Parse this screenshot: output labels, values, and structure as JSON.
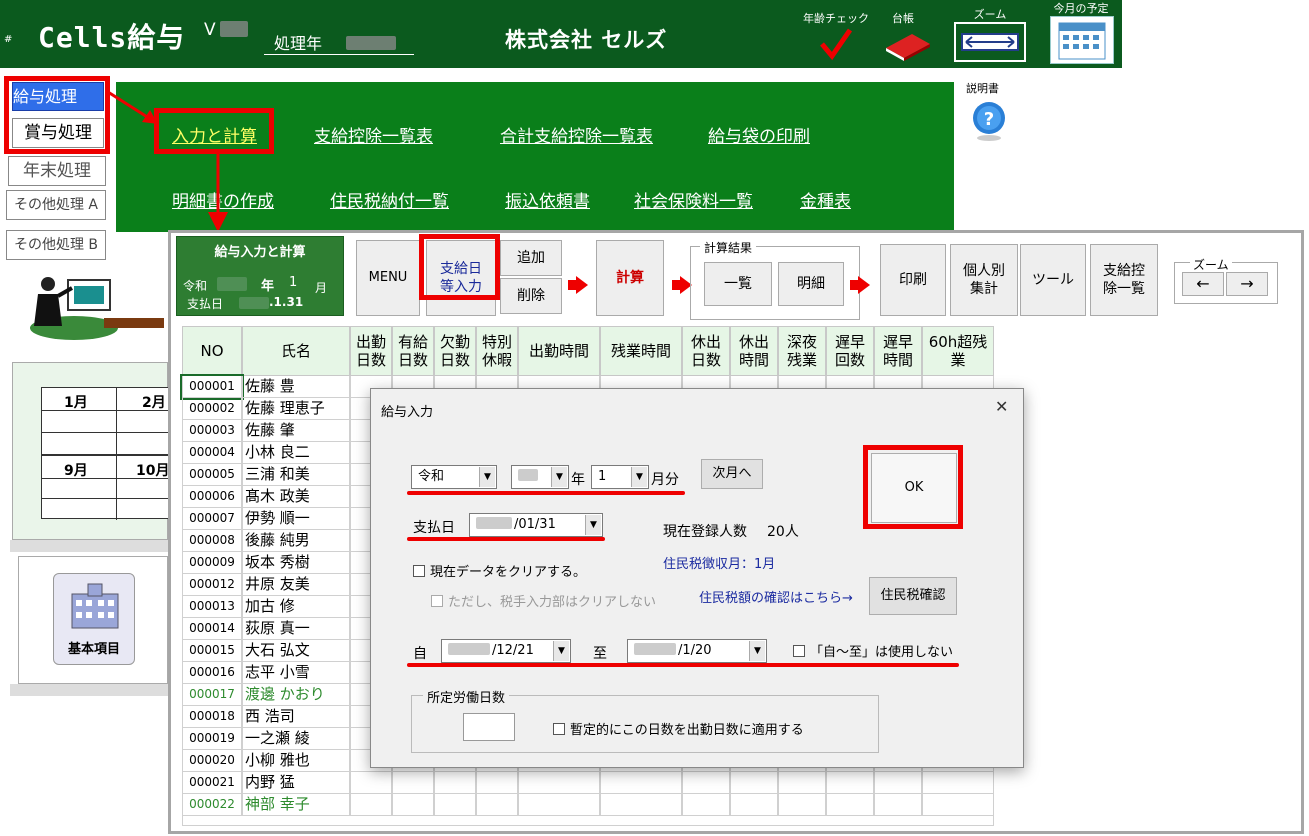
{
  "app": {
    "title": "Cells給与",
    "version_prefix": "V",
    "process_year_label": "処理年",
    "company": "株式会社 セルズ"
  },
  "top_icons": {
    "age_check": "年齢チェック",
    "ledger": "台帳",
    "zoom": "ズーム",
    "month_plan": "今月の予定",
    "manual": "説明書"
  },
  "left_nav": {
    "payroll": "給与処理",
    "bonus": "賞与処理",
    "year_end": "年末処理",
    "other_a": "その他処理 A",
    "other_b": "その他処理 B",
    "basic_items": "基本項目"
  },
  "calendar": {
    "m1": "1月",
    "m2": "2月",
    "m9": "9月",
    "m10": "10月"
  },
  "menu": {
    "input_calc": "入力と計算",
    "pay_deduct_list": "支給控除一覧表",
    "total_pay_deduct_list": "合計支給控除一覧表",
    "envelope_print": "給与袋の印刷",
    "statement": "明細書の作成",
    "resident_tax": "住民税納付一覧",
    "transfer": "振込依頼書",
    "social_ins": "社会保険料一覧",
    "denomination": "金種表"
  },
  "pane": {
    "title": "給与入力と計算",
    "era": "令和",
    "year_unit": "年",
    "month": "1",
    "month_unit": "月",
    "pay_label": "支払日",
    "pay_date": ".1.31"
  },
  "toolbar": {
    "menu": "MENU",
    "payday_input": "支給日\n等入力",
    "add": "追加",
    "delete": "削除",
    "calc": "計算",
    "result_group": "計算結果",
    "list": "一覧",
    "detail": "明細",
    "print": "印刷",
    "per_person": "個人別\n集計",
    "tools": "ツール",
    "pay_deduct": "支給控\n除一覧",
    "zoom_group": "ズーム",
    "zoom_left": "←",
    "zoom_right": "→"
  },
  "columns": [
    "NO",
    "氏名",
    "出勤\n日数",
    "有給\n日数",
    "欠勤\n日数",
    "特別\n休暇",
    "出勤時間",
    "残業時間",
    "休出\n日数",
    "休出\n時間",
    "深夜\n残業",
    "遅早\n回数",
    "遅早\n時間",
    "60h超残\n業"
  ],
  "employees": [
    {
      "no": "000001",
      "name": "佐藤 豊",
      "green": false
    },
    {
      "no": "000002",
      "name": "佐藤 理恵子",
      "green": false
    },
    {
      "no": "000003",
      "name": "佐藤 肇",
      "green": false
    },
    {
      "no": "000004",
      "name": "小林 良二",
      "green": false
    },
    {
      "no": "000005",
      "name": "三浦 和美",
      "green": false
    },
    {
      "no": "000006",
      "name": "髙木 政美",
      "green": false
    },
    {
      "no": "000007",
      "name": "伊勢 順一",
      "green": false
    },
    {
      "no": "000008",
      "name": "後藤 純男",
      "green": false
    },
    {
      "no": "000009",
      "name": "坂本 秀樹",
      "green": false
    },
    {
      "no": "000012",
      "name": "井原 友美",
      "green": false
    },
    {
      "no": "000013",
      "name": "加古 修",
      "green": false
    },
    {
      "no": "000014",
      "name": "荻原 真一",
      "green": false
    },
    {
      "no": "000015",
      "name": "大石 弘文",
      "green": false
    },
    {
      "no": "000016",
      "name": "志平 小雪",
      "green": false
    },
    {
      "no": "000017",
      "name": "渡邊 かおり",
      "green": true
    },
    {
      "no": "000018",
      "name": "西 浩司",
      "green": false
    },
    {
      "no": "000019",
      "name": "一之瀬 綾",
      "green": false
    },
    {
      "no": "000020",
      "name": "小柳 雅也",
      "green": false
    },
    {
      "no": "000021",
      "name": "内野 猛",
      "green": false
    },
    {
      "no": "000022",
      "name": "神部 幸子",
      "green": true
    }
  ],
  "dialog": {
    "title": "給与入力",
    "close": "✕",
    "era": "令和",
    "year_unit": "年",
    "month": "1",
    "month_unit": "月分",
    "next_month": "次月へ",
    "ok": "OK",
    "pay_label": "支払日",
    "pay_date": "/01/31",
    "registered": "現在登録人数",
    "registered_value": "20人",
    "tax_month": "住民税徴収月：1月",
    "clear_data": "現在データをクリアする。",
    "no_clear_manual": "ただし、税手入力部はクリアしない",
    "tax_confirm_link": "住民税額の確認はこちら→",
    "tax_confirm_btn": "住民税確認",
    "from_label": "自",
    "from_value": "/12/21",
    "to_label": "至",
    "to_value": "/1/20",
    "no_range": "「自～至」は使用しない",
    "work_days_group": "所定労働日数",
    "apply_work_days": "暫定的にこの日数を出勤日数に適用する"
  },
  "colors": {
    "brand_green": "#0b5a1e",
    "menu_green": "#0a7f1a",
    "highlight": "#e00000",
    "selected_blue": "#2f6ee9"
  }
}
